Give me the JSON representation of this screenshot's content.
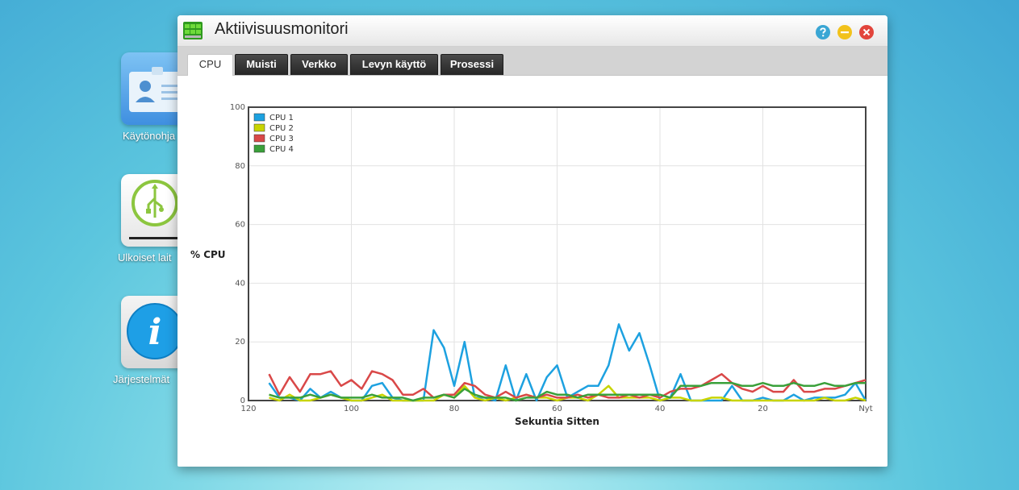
{
  "desktop": {
    "icons": [
      {
        "label": "Käytönohja",
        "icon": "user-card-icon"
      },
      {
        "label": "Ulkoiset lait",
        "icon": "usb-icon"
      },
      {
        "label": "Järjestelmät",
        "icon": "info-icon"
      }
    ]
  },
  "window": {
    "title": "Aktiivisuusmonitori",
    "icon": "activity-monitor-icon",
    "buttons": {
      "help": "help-icon",
      "minimize": "minimize-icon",
      "close": "close-icon"
    },
    "colors": {
      "help": "#3aa6d4",
      "minimize": "#f2c21b",
      "close": "#e2453c"
    }
  },
  "tabs": [
    {
      "label": "CPU",
      "active": true
    },
    {
      "label": "Muisti",
      "active": false
    },
    {
      "label": "Verkko",
      "active": false
    },
    {
      "label": "Levyn käyttö",
      "active": false
    },
    {
      "label": "Prosessi",
      "active": false
    }
  ],
  "chart_data": {
    "type": "line",
    "title": "",
    "xlabel": "Sekuntia Sitten",
    "ylabel": "% CPU",
    "x_ticks": [
      "120",
      "100",
      "80",
      "60",
      "40",
      "20",
      "Nyt"
    ],
    "y_ticks": [
      "0",
      "20",
      "40",
      "60",
      "80",
      "100"
    ],
    "xlim": [
      120,
      0
    ],
    "ylim": [
      0,
      100
    ],
    "grid": true,
    "legend_position": "top-left",
    "x": [
      116,
      114,
      112,
      110,
      108,
      106,
      104,
      102,
      100,
      98,
      96,
      94,
      92,
      90,
      88,
      86,
      84,
      82,
      80,
      78,
      76,
      74,
      72,
      70,
      68,
      66,
      64,
      62,
      60,
      58,
      56,
      54,
      52,
      50,
      48,
      46,
      44,
      42,
      40,
      38,
      36,
      34,
      32,
      30,
      28,
      26,
      24,
      22,
      20,
      18,
      16,
      14,
      12,
      10,
      8,
      6,
      4,
      2,
      0
    ],
    "series": [
      {
        "name": "CPU 1",
        "color": "#1da1e0",
        "values": [
          6,
          1,
          1,
          0,
          4,
          1,
          3,
          1,
          0,
          0,
          5,
          6,
          1,
          0,
          0,
          0,
          24,
          18,
          5,
          20,
          1,
          1,
          0,
          12,
          0,
          9,
          0,
          8,
          12,
          1,
          3,
          5,
          5,
          12,
          26,
          17,
          23,
          12,
          0,
          1,
          9,
          0,
          0,
          0,
          0,
          5,
          0,
          0,
          1,
          0,
          0,
          2,
          0,
          1,
          1,
          1,
          2,
          6,
          0
        ]
      },
      {
        "name": "CPU 2",
        "color": "#c8d400",
        "values": [
          1,
          0,
          2,
          0,
          0,
          1,
          2,
          1,
          0,
          0,
          1,
          2,
          0,
          0,
          0,
          0,
          0,
          2,
          1,
          5,
          1,
          0,
          1,
          0,
          1,
          2,
          1,
          1,
          0,
          1,
          1,
          0,
          2,
          5,
          1,
          1,
          1,
          1,
          0,
          1,
          1,
          0,
          0,
          1,
          1,
          0,
          0,
          0,
          0,
          0,
          0,
          0,
          0,
          0,
          1,
          0,
          0,
          1,
          0
        ]
      },
      {
        "name": "CPU 3",
        "color": "#d94848",
        "values": [
          9,
          2,
          8,
          3,
          9,
          9,
          10,
          5,
          7,
          4,
          10,
          9,
          7,
          2,
          2,
          4,
          1,
          2,
          2,
          6,
          5,
          2,
          1,
          3,
          1,
          2,
          1,
          2,
          1,
          1,
          2,
          1,
          2,
          1,
          1,
          2,
          1,
          2,
          1,
          3,
          4,
          4,
          5,
          7,
          9,
          6,
          4,
          3,
          5,
          3,
          3,
          7,
          3,
          3,
          4,
          4,
          5,
          6,
          7
        ]
      },
      {
        "name": "CPU 4",
        "color": "#3aa03a",
        "values": [
          2,
          1,
          1,
          1,
          2,
          1,
          2,
          1,
          1,
          1,
          2,
          1,
          1,
          1,
          0,
          1,
          1,
          2,
          1,
          4,
          2,
          1,
          1,
          1,
          0,
          1,
          1,
          3,
          2,
          2,
          1,
          2,
          2,
          2,
          2,
          2,
          2,
          2,
          2,
          1,
          5,
          5,
          5,
          6,
          6,
          6,
          5,
          5,
          6,
          5,
          5,
          6,
          5,
          5,
          6,
          5,
          5,
          6,
          6
        ]
      }
    ]
  }
}
